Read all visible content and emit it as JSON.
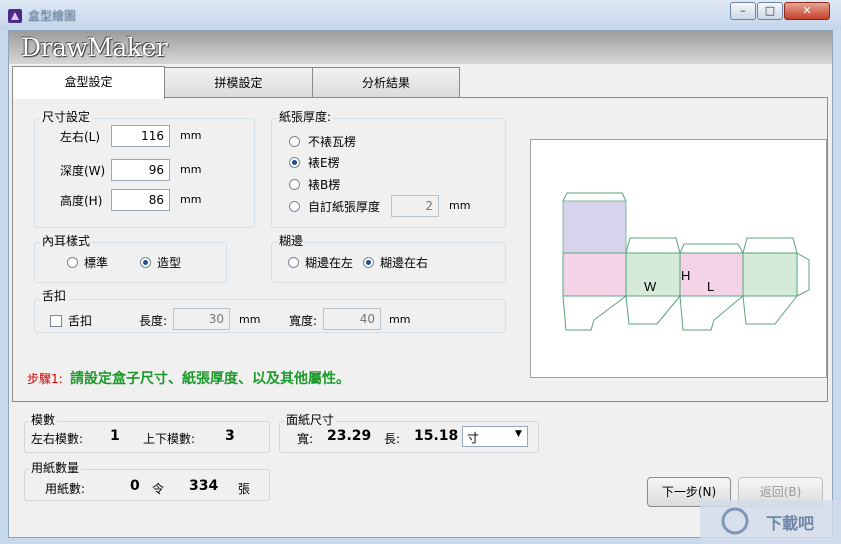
{
  "window": {
    "title": "盒型繪圖",
    "min_glyph": "–",
    "max_glyph": "□",
    "close_glyph": "✕"
  },
  "brand": "DrawMaker",
  "tabs": [
    {
      "label": "盒型設定",
      "active": true
    },
    {
      "label": "拼模設定",
      "active": false
    },
    {
      "label": "分析結果",
      "active": false
    }
  ],
  "size": {
    "title": "尺寸設定",
    "width_label": "左右(L)",
    "width_value": "116",
    "depth_label": "深度(W)",
    "depth_value": "96",
    "height_label": "高度(H)",
    "height_value": "86",
    "unit": "mm"
  },
  "paper": {
    "title": "紙張厚度:",
    "options": [
      "不裱瓦楞",
      "裱E楞",
      "裱B楞",
      "自訂紙張厚度"
    ],
    "selected": "裱E楞",
    "custom_value": "2",
    "unit": "mm"
  },
  "ear": {
    "title": "內耳樣式",
    "options": [
      "標準",
      "造型"
    ],
    "selected": "造型"
  },
  "glue": {
    "title": "糊邊",
    "options": [
      "糊邊在左",
      "糊邊在右"
    ],
    "selected": "糊邊在右"
  },
  "lock": {
    "title": "舌扣",
    "checkbox_label": "舌扣",
    "length_label": "長度:",
    "length_value": "30",
    "width_label": "寬度:",
    "width_value": "40",
    "unit": "mm"
  },
  "preview_labels": {
    "w": "W",
    "h": "H",
    "l": "L"
  },
  "step": {
    "prefix": "步驟1:",
    "text": "請設定盒子尺寸、紙張厚度、以及其他屬性。",
    "prefix_color": "#d40000",
    "text_color": "#1b9a2a"
  },
  "layout_count": {
    "title": "模數",
    "lr_label": "左右模數:",
    "lr_value": "1",
    "ud_label": "上下模數:",
    "ud_value": "3"
  },
  "sheet": {
    "title": "面紙尺寸",
    "width_label": "寬:",
    "width_value": "23.29",
    "length_label": "長:",
    "length_value": "15.18",
    "unit_selected": "寸"
  },
  "usage": {
    "title": "用紙數量",
    "label": "用紙數:",
    "ream_value": "0",
    "ream_unit": "令",
    "sheet_value": "334",
    "sheet_unit": "張"
  },
  "buttons": {
    "next": "下一步(N)",
    "prev": "返回(B)"
  },
  "watermark": "下載吧"
}
